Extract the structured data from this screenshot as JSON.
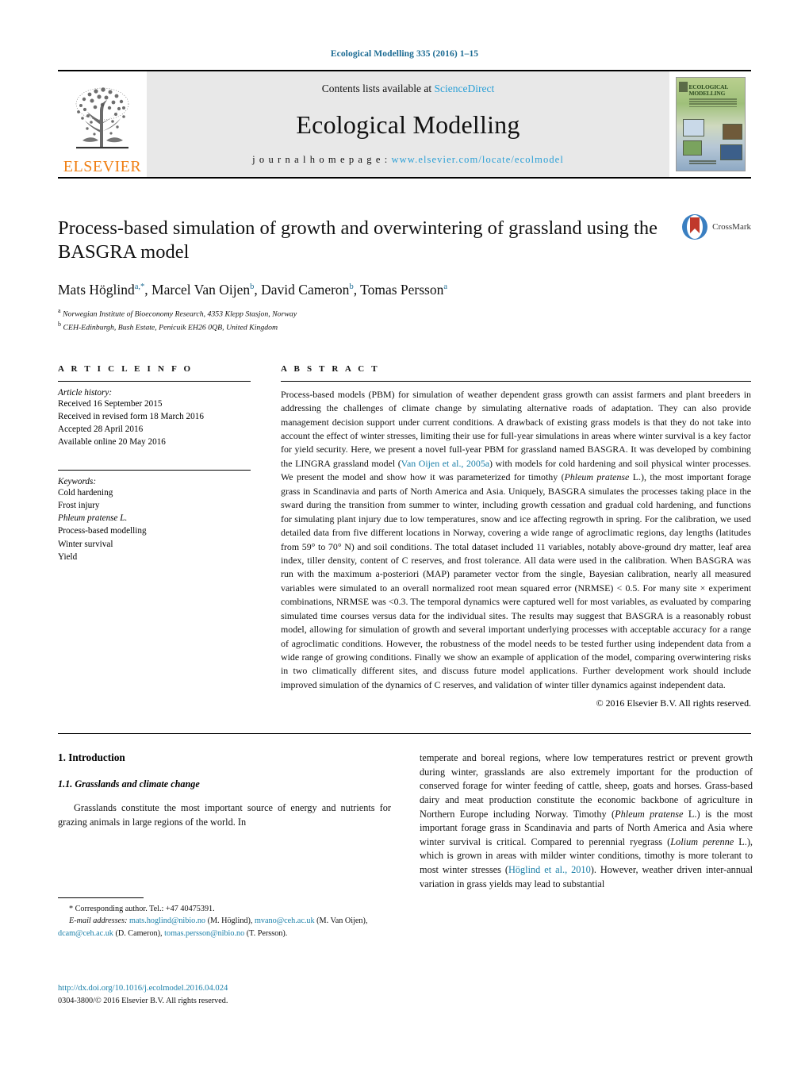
{
  "running_head": "Ecological Modelling 335 (2016) 1–15",
  "masthead": {
    "contents_prefix": "Contents lists available at ",
    "contents_link": "ScienceDirect",
    "journal_title": "Ecological Modelling",
    "homepage_prefix": "j o u r n a l   h o m e p a g e :  ",
    "homepage_url": "www.elsevier.com/locate/ecolmodel",
    "publisher": "ELSEVIER",
    "cover_title": "ECOLOGICAL MODELLING"
  },
  "article": {
    "title": "Process-based simulation of growth and overwintering of grassland using the BASGRA model",
    "crossmark_label": "CrossMark",
    "authors": [
      {
        "name": "Mats Höglind",
        "marks": "a,*"
      },
      {
        "name": "Marcel Van Oijen",
        "marks": "b"
      },
      {
        "name": "David Cameron",
        "marks": "b"
      },
      {
        "name": "Tomas Persson",
        "marks": "a"
      }
    ],
    "affiliations": [
      {
        "mark": "a",
        "text": "Norwegian Institute of Bioeconomy Research, 4353 Klepp Stasjon, Norway"
      },
      {
        "mark": "b",
        "text": "CEH-Edinburgh, Bush Estate, Penicuik EH26 0QB, United Kingdom"
      }
    ]
  },
  "article_info": {
    "heading": "A R T I C L E   I N F O",
    "history_label": "Article history:",
    "history": [
      "Received 16 September 2015",
      "Received in revised form 18 March 2016",
      "Accepted 28 April 2016",
      "Available online 20 May 2016"
    ],
    "keywords_label": "Keywords:",
    "keywords": [
      "Cold hardening",
      "Frost injury",
      "Phleum pratense L.",
      "Process-based modelling",
      "Winter survival",
      "Yield"
    ]
  },
  "abstract": {
    "heading": "A B S T R A C T",
    "part1": "Process-based models (PBM) for simulation of weather dependent grass growth can assist farmers and plant breeders in addressing the challenges of climate change by simulating alternative roads of adaptation. They can also provide management decision support under current conditions. A drawback of existing grass models is that they do not take into account the effect of winter stresses, limiting their use for full-year simulations in areas where winter survival is a key factor for yield security. Here, we present a novel full-year PBM for grassland named BASGRA. It was developed by combining the LINGRA grassland model (",
    "citation1": "Van Oijen et al., 2005a",
    "part2": ") with models for cold hardening and soil physical winter processes. We present the model and show how it was parameterized for timothy (",
    "italic1": "Phleum pratense",
    "part3": " L.), the most important forage grass in Scandinavia and parts of North America and Asia. Uniquely, BASGRA simulates the processes taking place in the sward during the transition from summer to winter, including growth cessation and gradual cold hardening, and functions for simulating plant injury due to low temperatures, snow and ice affecting regrowth in spring. For the calibration, we used detailed data from five different locations in Norway, covering a wide range of agroclimatic regions, day lengths (latitudes from 59° to 70° N) and soil conditions. The total dataset included 11 variables, notably above-ground dry matter, leaf area index, tiller density, content of C reserves, and frost tolerance. All data were used in the calibration. When BASGRA was run with the maximum a-posteriori (MAP) parameter vector from the single, Bayesian calibration, nearly all measured variables were simulated to an overall normalized root mean squared error (NRMSE) < 0.5. For many site × experiment combinations, NRMSE was <0.3. The temporal dynamics were captured well for most variables, as evaluated by comparing simulated time courses versus data for the individual sites. The results may suggest that BASGRA is a reasonably robust model, allowing for simulation of growth and several important underlying processes with acceptable accuracy for a range of agroclimatic conditions. However, the robustness of the model needs to be tested further using independent data from a wide range of growing conditions. Finally we show an example of application of the model, comparing overwintering risks in two climatically different sites, and discuss future model applications. Further development work should include improved simulation of the dynamics of C reserves, and validation of winter tiller dynamics against independent data.",
    "copyright": "© 2016 Elsevier B.V. All rights reserved."
  },
  "body": {
    "section_number_title": "1. Introduction",
    "subsection_number_title": "1.1. Grasslands and climate change",
    "left_para1": "Grasslands constitute the most important source of energy and nutrients for grazing animals in large regions of the world. In",
    "right_part1": "temperate and boreal regions, where low temperatures restrict or prevent growth during winter, grasslands are also extremely important for the production of conserved forage for winter feeding of cattle, sheep, goats and horses. Grass-based dairy and meat production constitute the economic backbone of agriculture in Northern Europe including Norway. Timothy (",
    "right_italic1": "Phleum pratense",
    "right_part2": " L.) is the most important forage grass in Scandinavia and parts of North America and Asia where winter survival is critical. Compared to perennial ryegrass (",
    "right_italic2": "Lolium perenne",
    "right_part3": " L.), which is grown in areas with milder winter conditions, timothy is more tolerant to most winter stresses (",
    "right_citation": "Höglind et al., 2010",
    "right_part4": "). However, weather driven inter-annual variation in grass yields may lead to substantial"
  },
  "footnotes": {
    "corresponding": "* Corresponding author. Tel.: +47 40475391.",
    "email_label": "E-mail addresses:",
    "emails": [
      {
        "address": "mats.hoglind@nibio.no",
        "owner": " (M. Höglind), "
      },
      {
        "address": "mvano@ceh.ac.uk",
        "owner": " (M. Van Oijen), "
      },
      {
        "address": "dcam@ceh.ac.uk",
        "owner": " (D. Cameron), "
      },
      {
        "address": "tomas.persson@nibio.no",
        "owner": " (T. Persson)."
      }
    ],
    "doi": "http://dx.doi.org/10.1016/j.ecolmodel.2016.04.024",
    "issn": "0304-3800/© 2016 Elsevier B.V. All rights reserved."
  },
  "colors": {
    "link": "#1a7fa8",
    "running_head": "#1a6a92",
    "elsevier_orange": "#f07f13",
    "masthead_bg": "#e8e8e8"
  }
}
